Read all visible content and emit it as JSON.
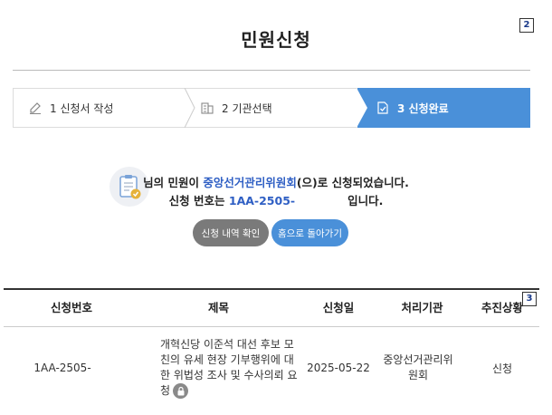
{
  "header": {
    "title": "민원신청",
    "badge_top": "2"
  },
  "steps": [
    {
      "label": "1 신청서 작성",
      "icon": "pencil-icon",
      "active": false
    },
    {
      "label": "2 기관선택",
      "icon": "building-icon",
      "active": false
    },
    {
      "label": "3 신청완료",
      "icon": "document-check-icon",
      "active": true
    }
  ],
  "result": {
    "msg_prefix": "님의 민원이 ",
    "agency": "중앙선거관리위원회",
    "msg_suffix": "(으)로 신청되었습니다.",
    "number_label": "신청 번호는 ",
    "number": "1AA-2505-",
    "number_suffix": "입니다.",
    "icon": "clipboard-check-icon"
  },
  "buttons": {
    "history": "신청 내역 확인",
    "home": "홈으로 돌아가기"
  },
  "table": {
    "badge": "3",
    "headers": [
      "신청번호",
      "제목",
      "신청일",
      "처리기관",
      "추진상황"
    ],
    "rows": [
      {
        "number": "1AA-2505-",
        "title_lines": [
          "개혁신당 이준석 대선 후보 모",
          "친의 유세 현장 기부행위에 대",
          "한 위법성 조사 및 수사의뢰 요",
          "청"
        ],
        "date": "2025-05-22",
        "agency": "중앙선거관리위원회",
        "status": "신청"
      }
    ]
  },
  "colors": {
    "accent": "#4a90d9",
    "agency_text": "#2f5fc4",
    "gray_button": "#7a7a7a"
  }
}
